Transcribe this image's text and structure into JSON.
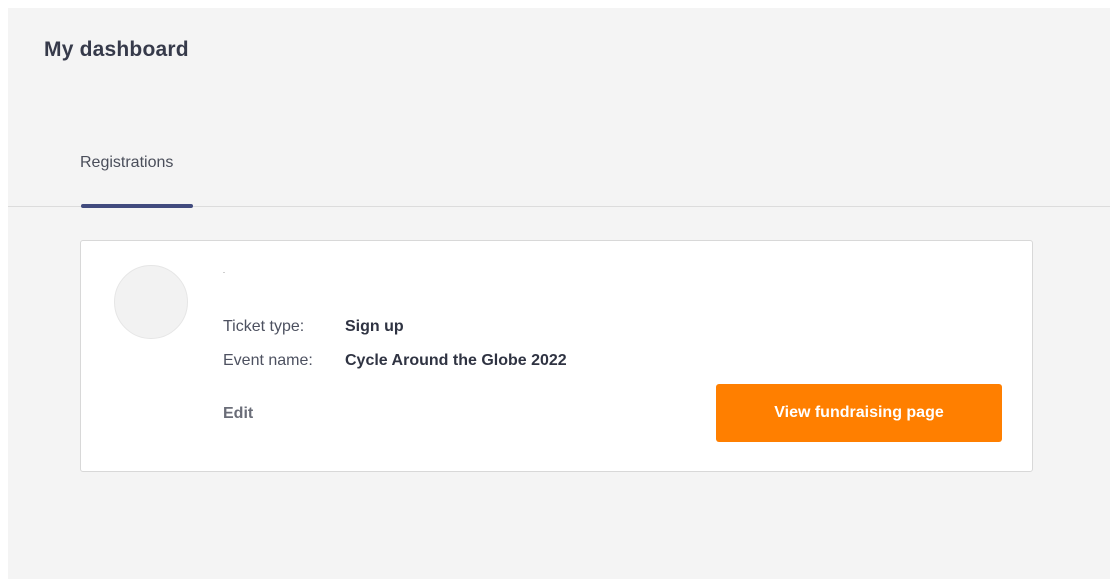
{
  "header": {
    "title": "My dashboard"
  },
  "tabs": [
    {
      "label": "Registrations",
      "active": true
    }
  ],
  "registration": {
    "name": "",
    "ticket_type_label": "Ticket type:",
    "ticket_type_value": "Sign up",
    "event_name_label": "Event name:",
    "event_name_value": "Cycle Around the Globe 2022",
    "edit_label": "Edit",
    "cta_label": "View fundraising page"
  },
  "colors": {
    "accent": "#ff7f00",
    "tab_indicator": "#414b7e",
    "background": "#f4f4f4"
  }
}
